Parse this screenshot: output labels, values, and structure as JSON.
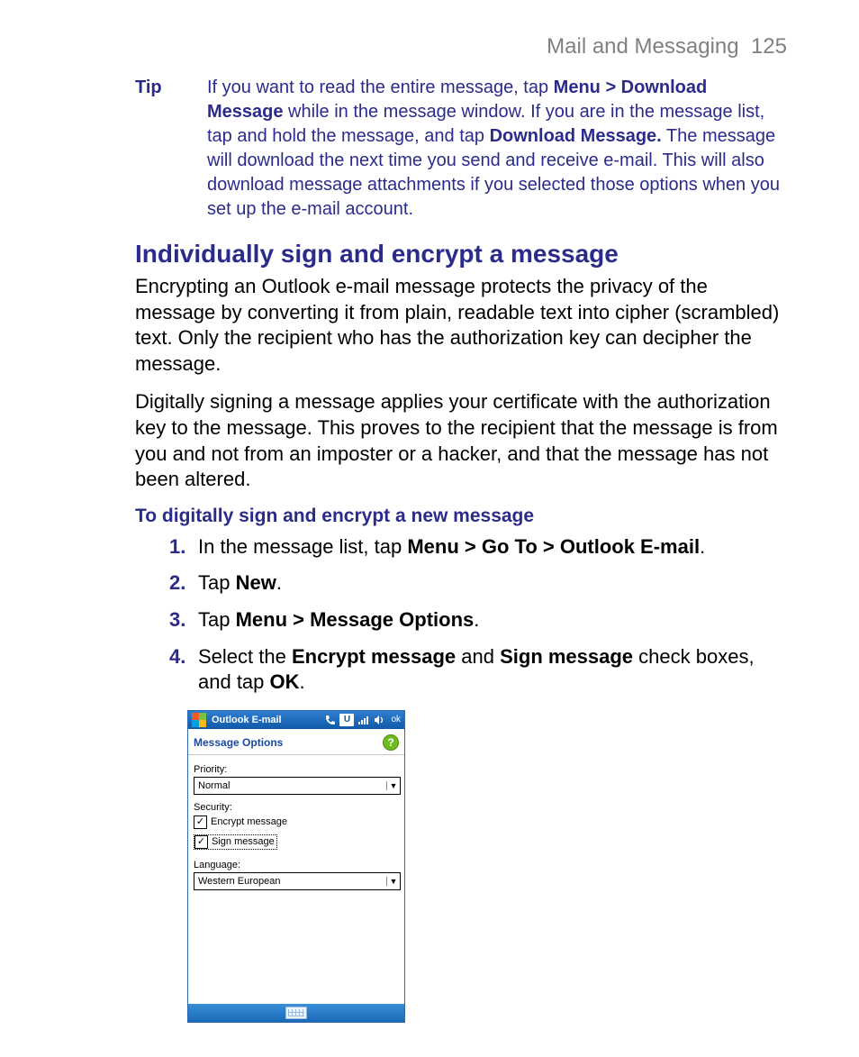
{
  "header": {
    "section": "Mail and Messaging",
    "page": "125"
  },
  "tip": {
    "label": "Tip",
    "pre": "If you want to read the entire message, tap ",
    "bold1": "Menu > Download Message",
    "mid1": " while in the message window. If you are in the message list, tap and hold the message, and tap ",
    "bold2": "Download Message.",
    "post": " The message will download the next time you send and receive e-mail. This will also download message attachments if you selected those options when you set up the e-mail account."
  },
  "section_heading": "Individually sign and encrypt a message",
  "para1": "Encrypting an Outlook e-mail message protects the privacy of the message by converting it from plain, readable text into cipher (scrambled) text. Only the recipient who has the authorization key can decipher the message.",
  "para2": "Digitally signing a message applies your certificate with the authorization key to the message. This proves to the recipient that the message is from you and not from an imposter or a hacker, and that the message has not been altered.",
  "sub_heading": "To digitally sign and encrypt a new message",
  "steps": [
    {
      "num": "1.",
      "pre": "In the message list, tap ",
      "bold": "Menu > Go To > Outlook E-mail",
      "post": "."
    },
    {
      "num": "2.",
      "pre": "Tap ",
      "bold": "New",
      "post": "."
    },
    {
      "num": "3.",
      "pre": "Tap ",
      "bold": "Menu > Message Options",
      "post": "."
    },
    {
      "num": "4.",
      "pre": "Select the ",
      "bold": "Encrypt message",
      "mid": " and ",
      "bold2": "Sign message",
      "post2": " check boxes, and tap ",
      "bold3": "OK",
      "post3": "."
    }
  ],
  "device": {
    "title": "Outlook E-mail",
    "ok": "ok",
    "subheader": "Message Options",
    "help": "?",
    "priority_label": "Priority:",
    "priority_value": "Normal",
    "security_label": "Security:",
    "encrypt_label": "Encrypt message",
    "sign_label": "Sign message",
    "language_label": "Language:",
    "language_value": "Western European",
    "check_mark": "✓"
  }
}
